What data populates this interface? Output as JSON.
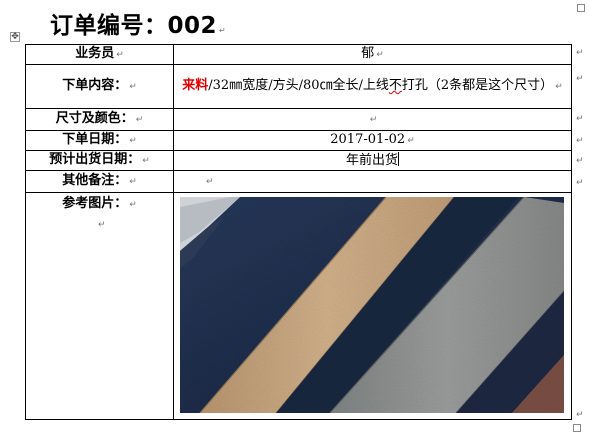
{
  "document": {
    "title": "订单编号：002",
    "paragraph_mark": "↵",
    "move_handle_glyph": "✥"
  },
  "rows": [
    {
      "label": "业务员",
      "value": "郁"
    },
    {
      "label": "下单内容：",
      "value_parts": {
        "highlight": "来料",
        "rest_1": "/32㎜宽度/方头/80㎝全长/上线",
        "squiggle": "不",
        "rest_2": "打孔（2条都是这个尺寸）"
      }
    },
    {
      "label": "尺寸及颜色：",
      "value": ""
    },
    {
      "label": "下单日期：",
      "value": "2017-01-02"
    },
    {
      "label": "预计出货日期：",
      "value": "年前出货"
    },
    {
      "label": "其他备注：",
      "value": ""
    },
    {
      "label": "参考图片：",
      "value": ""
    }
  ],
  "reference_image": {
    "icon": "leather-strips-photo",
    "colors": {
      "navy": "#1e2d44",
      "navy_dark": "#141e30",
      "tan": "#c8a882",
      "grey": "#8a8e8e",
      "brown": "#7a4f44"
    }
  }
}
